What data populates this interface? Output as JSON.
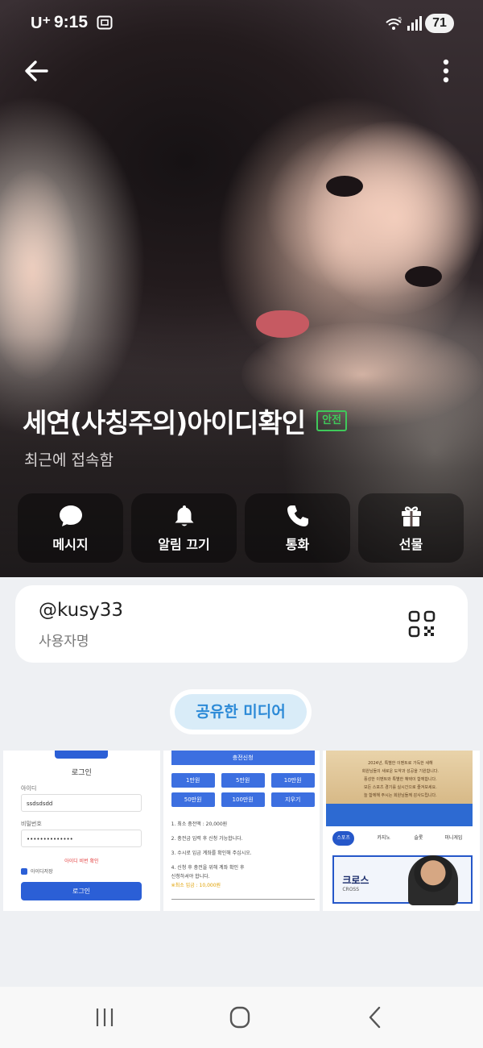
{
  "status_bar": {
    "carrier": "U⁺",
    "time": "9:15",
    "battery": "71",
    "icons": [
      "screenshot-icon",
      "wifi-icon",
      "signal-icon"
    ]
  },
  "header": {
    "back_icon": "arrow-left-icon",
    "more_icon": "more-vertical-icon"
  },
  "profile": {
    "name": "세연(사칭주의)아이디확인",
    "badge": "안전",
    "last_seen": "최근에 접속함"
  },
  "actions": [
    {
      "label": "메시지",
      "icon": "message-icon"
    },
    {
      "label": "알림 끄기",
      "icon": "bell-icon"
    },
    {
      "label": "통화",
      "icon": "phone-icon"
    },
    {
      "label": "선물",
      "icon": "gift-icon"
    }
  ],
  "user_card": {
    "username": "@kusy33",
    "caption": "사용자명",
    "qr_icon": "qr-code-icon"
  },
  "shared_media": {
    "label": "공유한 미디어",
    "thumb_login": {
      "title": "로그인",
      "id_label": "아이디",
      "id_value": "ssdsdsdd",
      "pw_label": "비밀번호",
      "pw_value": "••••••••••••••",
      "error": "아이디 비번 확인",
      "remember": "아이디저장",
      "button": "로그인"
    },
    "thumb_deposit": {
      "header": "충전신청",
      "amounts": [
        "1만원",
        "5만원",
        "10만원",
        "50만원",
        "100만원",
        "지우기"
      ],
      "notes": [
        "1. 최소 충전액 : 20,000원",
        "2. 충전금 입력 후 신청 가능합니다.",
        "3. 수시로 입금 계좌를 확인해 주십시오.",
        "4. 신청 후 충전을 위해 계좌 확인 후",
        "   신청하셔야 합니다.",
        "※최소 입금 : 10,000원"
      ]
    },
    "thumb_sports": {
      "banner_lines": [
        "2024년, 특별한 이벤트로 가득한 새해",
        "회원님들의 새로운 도약과 성공을 기원합니다.",
        "풍성한 이벤트와 특별한 혜택이 함께합니다.",
        "모든 스포츠 경기를 실시간으로 즐겨보세요.",
        "늘 함께해 주시는 회원님들께 감사드립니다."
      ],
      "tabs": [
        "스포츠",
        "카지노",
        "슬롯",
        "미니게임"
      ],
      "promo_title": "크로스",
      "promo_sub": "CROSS"
    }
  },
  "nav_bar": {
    "recent_icon": "recent-apps-icon",
    "home_icon": "home-icon",
    "back_icon": "nav-back-icon"
  }
}
